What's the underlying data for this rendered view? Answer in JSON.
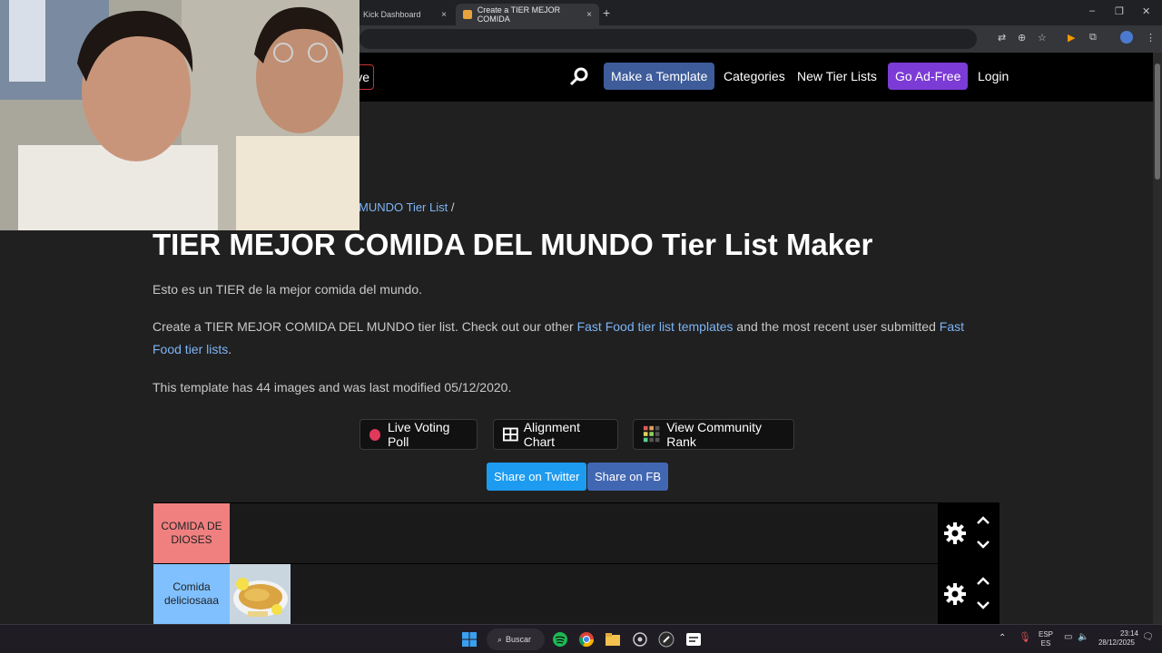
{
  "browser": {
    "tabs": [
      {
        "label": "Kick Dashboard",
        "active": false
      },
      {
        "label": "Create a TIER MEJOR COMIDA",
        "active": true
      }
    ],
    "new_tab": "+",
    "close": "×",
    "window_controls": [
      "–",
      "❐",
      "✕"
    ]
  },
  "nav": {
    "partial_button": "ve",
    "make_template": "Make a Template",
    "categories": "Categories",
    "new_tier_lists": "New Tier Lists",
    "go_ad_free": "Go Ad-Free",
    "login": "Login"
  },
  "breadcrumb": {
    "link": "MUNDO Tier List",
    "separator": "/"
  },
  "page": {
    "title": "TIER MEJOR COMIDA DEL MUNDO Tier List Maker",
    "description": "Esto es un TIER de la mejor comida del mundo.",
    "intro_a": "Create a TIER MEJOR COMIDA DEL MUNDO tier list. Check out our other ",
    "intro_link1": "Fast Food tier list templates",
    "intro_b": " and the most recent user submitted ",
    "intro_link2": "Fast Food tier lists",
    "intro_c": ".",
    "meta": "This template has 44 images and was last modified 05/12/2020."
  },
  "actions": {
    "live_voting": "Live Voting Poll",
    "alignment_chart": "Alignment Chart",
    "community_rank": "View Community Rank",
    "share_twitter": "Share on Twitter",
    "share_fb": "Share on FB"
  },
  "tiers": [
    {
      "label": "COMIDA DE DIOSES",
      "color": "#f08080"
    },
    {
      "label": "Comida deliciosaaa",
      "color": "#80c0ff"
    }
  ],
  "taskbar": {
    "search_label": "Buscar",
    "lang_top": "ESP",
    "lang_bottom": "ES",
    "time": "23:14",
    "date": "28/12/2025"
  },
  "colors": {
    "make_template_bg": "#3e5c9a",
    "ad_free_bg": "#7c3bd6",
    "twitter": "#1d9bf0",
    "facebook": "#4267b2",
    "link": "#7db4f5"
  }
}
